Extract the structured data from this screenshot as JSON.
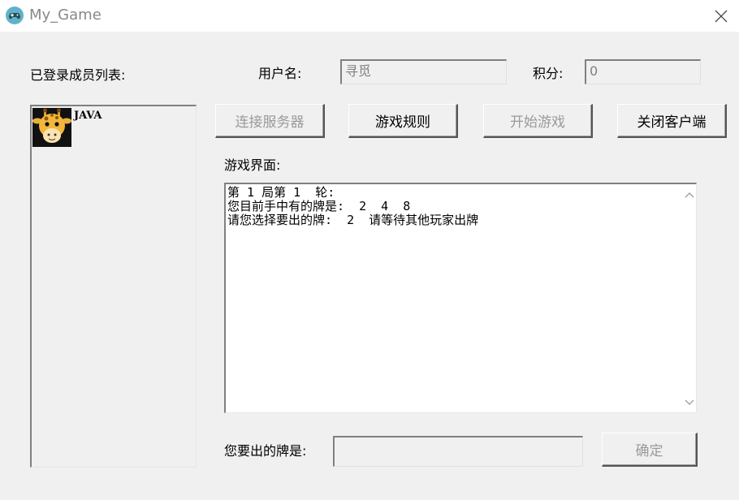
{
  "window": {
    "title": "My_Game",
    "app_icon": "gamepad-icon",
    "close_icon": "close-icon"
  },
  "labels": {
    "members": "已登录成员列表:",
    "username": "用户名:",
    "score": "积分:",
    "game_area": "游戏界面:",
    "card_prompt": "您要出的牌是:"
  },
  "fields": {
    "username_value": "寻觅",
    "score_value": "0",
    "card_value": ""
  },
  "members": [
    {
      "name": "JAVA",
      "avatar": "giraffe-avatar"
    }
  ],
  "buttons": {
    "connect": "连接服务器",
    "rules": "游戏规则",
    "start": "开始游戏",
    "close_client": "关闭客户端",
    "confirm": "确定"
  },
  "game_text": "第 1 局第 1  轮:\n您目前手中有的牌是:  2  4  8\n请您选择要出的牌:  2  请等待其他玩家出牌",
  "scrollbar": {
    "up_icon": "chevron-up-icon",
    "down_icon": "chevron-down-icon"
  }
}
